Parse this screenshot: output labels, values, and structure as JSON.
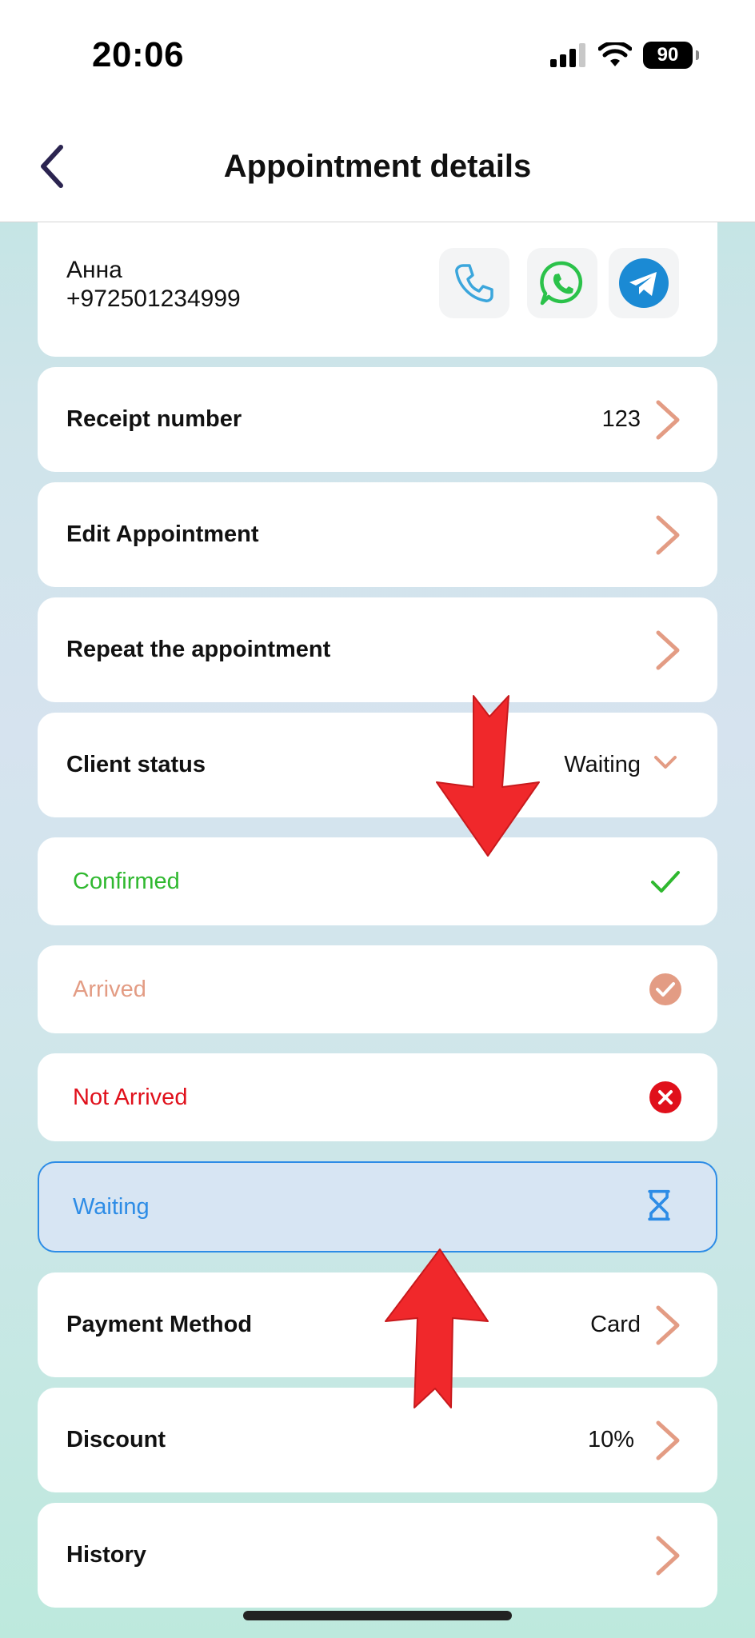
{
  "status_bar": {
    "time": "20:06",
    "battery": "90"
  },
  "header": {
    "title": "Appointment details"
  },
  "client": {
    "name": "Анна",
    "phone": "+972501234999"
  },
  "rows": {
    "receipt": {
      "label": "Receipt number",
      "value": "123"
    },
    "edit": {
      "label": "Edit Appointment"
    },
    "repeat": {
      "label": "Repeat the appointment"
    },
    "client_status": {
      "label": "Client status",
      "value": "Waiting"
    },
    "payment": {
      "label": "Payment Method",
      "value": "Card"
    },
    "discount": {
      "label": "Discount",
      "value": "10%"
    },
    "history": {
      "label": "History"
    }
  },
  "status_options": [
    {
      "label": "Confirmed",
      "color": "#2fb82f"
    },
    {
      "label": "Arrived",
      "color": "#e39c84"
    },
    {
      "label": "Not Arrived",
      "color": "#e0101b"
    },
    {
      "label": "Waiting",
      "color": "#2d8ce6",
      "selected": true
    }
  ],
  "colors": {
    "accent_chevron": "#e39c84",
    "arrow_annotation": "#f0282b",
    "back": "#2b2450"
  }
}
